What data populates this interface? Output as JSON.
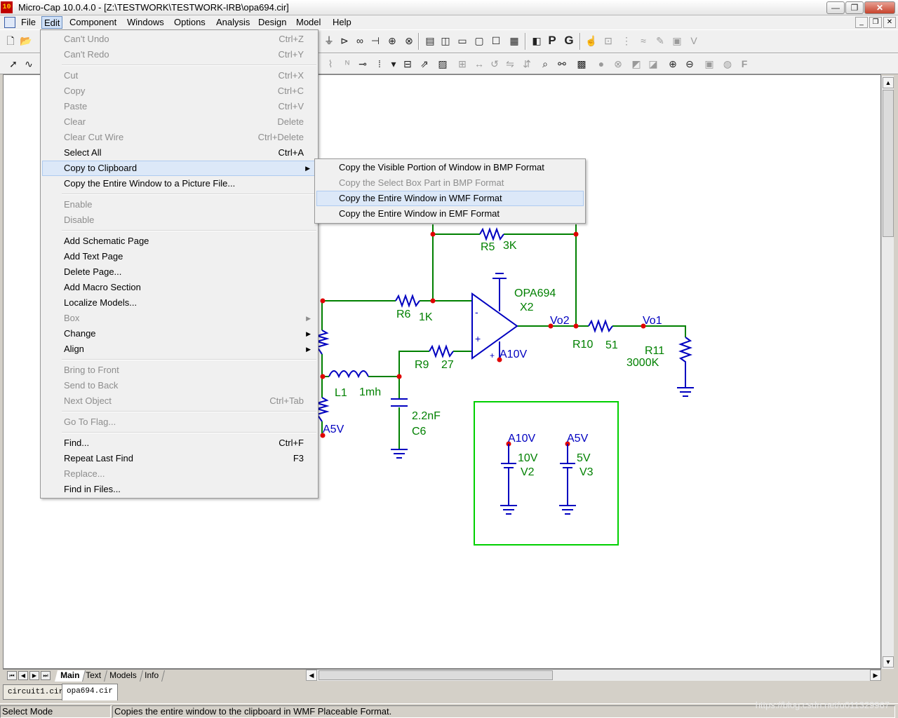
{
  "window": {
    "title": "Micro-Cap 10.0.4.0 - [Z:\\TESTWORK\\TESTWORK-IRB\\opa694.cir]",
    "app_icon_text": "10",
    "min": "—",
    "restore": "❐",
    "close": "✕"
  },
  "menubar": {
    "items": [
      "File",
      "Edit",
      "Component",
      "Windows",
      "Options",
      "Analysis",
      "Design",
      "Model",
      "Help"
    ]
  },
  "edit_menu": {
    "items": [
      {
        "label": "Can't Undo",
        "accel": "Ctrl+Z"
      },
      {
        "label": "Can't Redo",
        "accel": "Ctrl+Y"
      },
      {
        "label": "Cut",
        "accel": "Ctrl+X"
      },
      {
        "label": "Copy",
        "accel": "Ctrl+C"
      },
      {
        "label": "Paste",
        "accel": "Ctrl+V"
      },
      {
        "label": "Clear",
        "accel": "Delete"
      },
      {
        "label": "Clear Cut Wire",
        "accel": "Ctrl+Delete"
      },
      {
        "label": "Select All",
        "accel": "Ctrl+A"
      },
      {
        "label": "Copy to Clipboard",
        "accel": ""
      },
      {
        "label": "Copy the Entire Window to a Picture File...",
        "accel": ""
      },
      {
        "label": "Enable",
        "accel": ""
      },
      {
        "label": "Disable",
        "accel": ""
      },
      {
        "label": "Add Schematic Page",
        "accel": ""
      },
      {
        "label": "Add Text Page",
        "accel": ""
      },
      {
        "label": "Delete Page...",
        "accel": ""
      },
      {
        "label": "Add Macro Section",
        "accel": ""
      },
      {
        "label": "Localize Models...",
        "accel": ""
      },
      {
        "label": "Box",
        "accel": ""
      },
      {
        "label": "Change",
        "accel": ""
      },
      {
        "label": "Align",
        "accel": ""
      },
      {
        "label": "Bring to Front",
        "accel": ""
      },
      {
        "label": "Send to Back",
        "accel": ""
      },
      {
        "label": "Next Object",
        "accel": "Ctrl+Tab"
      },
      {
        "label": "Go To Flag...",
        "accel": ""
      },
      {
        "label": "Find...",
        "accel": "Ctrl+F"
      },
      {
        "label": "Repeat Last Find",
        "accel": "F3"
      },
      {
        "label": "Replace...",
        "accel": ""
      },
      {
        "label": "Find in Files...",
        "accel": ""
      }
    ]
  },
  "clipboard_submenu": {
    "items": [
      "Copy the Visible Portion of Window in BMP Format",
      "Copy the Select Box Part in BMP Format",
      "Copy the Entire Window in WMF Format",
      "Copy the Entire Window in EMF Format"
    ]
  },
  "schematic": {
    "r5": "R5",
    "r5_val": "3K",
    "opamp": "OPA694",
    "opamp_ref": "X2",
    "r6": "R6",
    "r6_val": "1K",
    "vo2": "Vo2",
    "vo1": "Vo1",
    "r10": "R10",
    "r10_val": "51",
    "r11": "R11",
    "r11_val": "3000K",
    "a10v": "A10V",
    "r9": "R9",
    "r9_val": "27",
    "l1": "L1",
    "l1_val": "1mh",
    "c6_val": "2.2nF",
    "c6": "C6",
    "a5v": "A5V",
    "minus": "-",
    "plus": "+",
    "box_a10v": "A10V",
    "v2_val": "10V",
    "v2": "V2",
    "box_a5v": "A5V",
    "v3_val": "5V",
    "v3": "V3"
  },
  "page_tabs": [
    "Main",
    "Text",
    "Models",
    "Info"
  ],
  "file_tabs": [
    "circuit1.cir",
    "opa694.cir"
  ],
  "status": {
    "mode": "Select Mode",
    "message": "Copies the entire window to the clipboard in WMF Placeable Format."
  },
  "watermark": "https://blog.csdn.net/u011329967",
  "colors": {
    "wire": "#008000",
    "component": "#0000c0",
    "node": "#e00000",
    "label": "#008000",
    "box": "#00d000"
  }
}
